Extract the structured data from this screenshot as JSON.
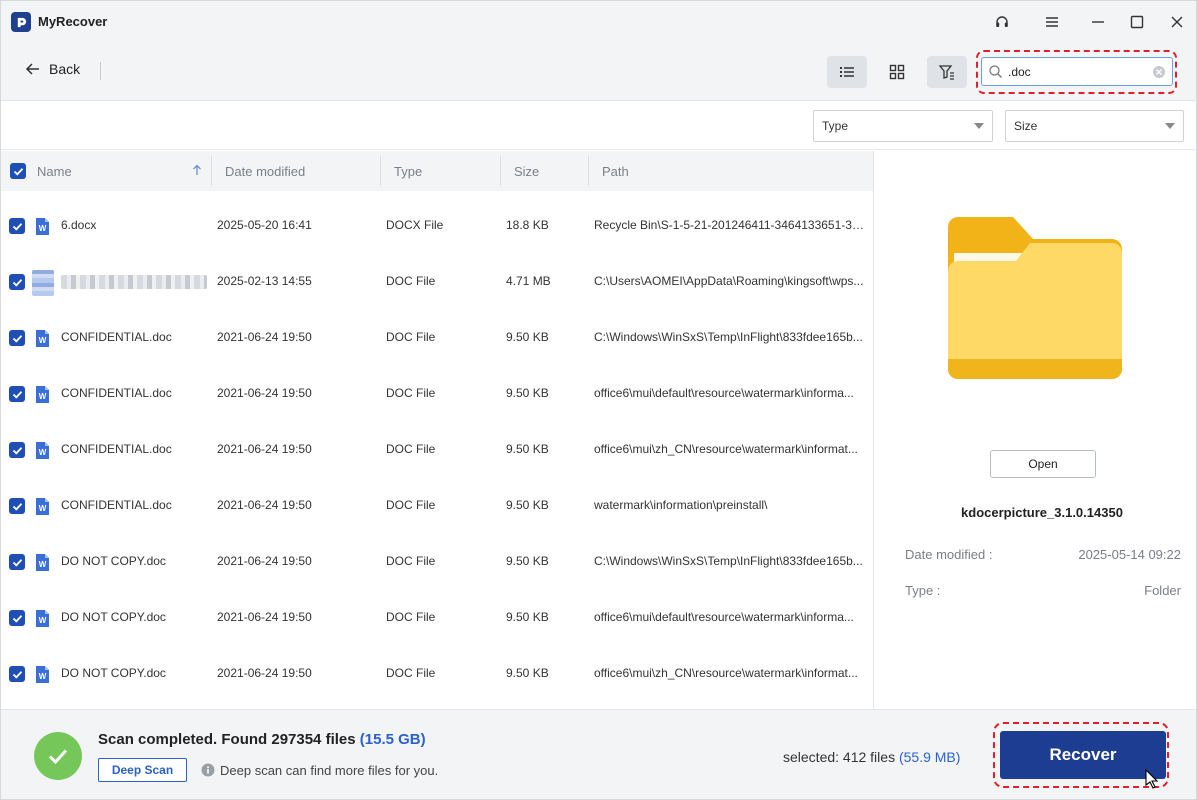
{
  "app": {
    "title": "MyRecover"
  },
  "toolbar": {
    "back_label": "Back",
    "search_value": ".doc"
  },
  "filters": {
    "type_label": "Type",
    "size_label": "Size"
  },
  "table": {
    "columns": {
      "name": "Name",
      "date": "Date modified",
      "type": "Type",
      "size": "Size",
      "path": "Path"
    },
    "rows": [
      {
        "name": "6.docx",
        "date": "2025-05-20 16:41",
        "type": "DOCX File",
        "size": "18.8 KB",
        "path": "Recycle Bin\\S-1-5-21-201246411-3464133651-3812...",
        "checked": true
      },
      {
        "name": "",
        "date": "2025-02-13 14:55",
        "type": "DOC File",
        "size": "4.71 MB",
        "path": "C:\\Users\\AOMEI\\AppData\\Roaming\\kingsoft\\wps...",
        "checked": true,
        "blurred": true
      },
      {
        "name": "CONFIDENTIAL.doc",
        "date": "2021-06-24 19:50",
        "type": "DOC File",
        "size": "9.50 KB",
        "path": "C:\\Windows\\WinSxS\\Temp\\InFlight\\833fdee165b...",
        "checked": true
      },
      {
        "name": "CONFIDENTIAL.doc",
        "date": "2021-06-24 19:50",
        "type": "DOC File",
        "size": "9.50 KB",
        "path": "office6\\mui\\default\\resource\\watermark\\informa...",
        "checked": true
      },
      {
        "name": "CONFIDENTIAL.doc",
        "date": "2021-06-24 19:50",
        "type": "DOC File",
        "size": "9.50 KB",
        "path": "office6\\mui\\zh_CN\\resource\\watermark\\informat...",
        "checked": true
      },
      {
        "name": "CONFIDENTIAL.doc",
        "date": "2021-06-24 19:50",
        "type": "DOC File",
        "size": "9.50 KB",
        "path": "watermark\\information\\preinstall\\",
        "checked": true
      },
      {
        "name": "DO NOT COPY.doc",
        "date": "2021-06-24 19:50",
        "type": "DOC File",
        "size": "9.50 KB",
        "path": "C:\\Windows\\WinSxS\\Temp\\InFlight\\833fdee165b...",
        "checked": true
      },
      {
        "name": "DO NOT COPY.doc",
        "date": "2021-06-24 19:50",
        "type": "DOC File",
        "size": "9.50 KB",
        "path": "office6\\mui\\default\\resource\\watermark\\informa...",
        "checked": true
      },
      {
        "name": "DO NOT COPY.doc",
        "date": "2021-06-24 19:50",
        "type": "DOC File",
        "size": "9.50 KB",
        "path": "office6\\mui\\zh_CN\\resource\\watermark\\informat...",
        "checked": true
      }
    ]
  },
  "preview": {
    "open_label": "Open",
    "name": "kdocerpicture_3.1.0.14350",
    "date_label": "Date modified :",
    "date_value": "2025-05-14 09:22",
    "type_label": "Type :",
    "type_value": "Folder"
  },
  "footer": {
    "scan_prefix": "Scan completed. Found 297354 files",
    "scan_size": "(15.5 GB)",
    "deep_scan_label": "Deep Scan",
    "deep_scan_hint": "Deep scan can find more files for you.",
    "selected_prefix": "selected: 412 files",
    "selected_size": "(55.9 MB)",
    "recover_label": "Recover"
  },
  "colors": {
    "accent": "#1d3d92",
    "link": "#2a62c9",
    "success": "#76c75a",
    "highlight": "#e0202a"
  }
}
